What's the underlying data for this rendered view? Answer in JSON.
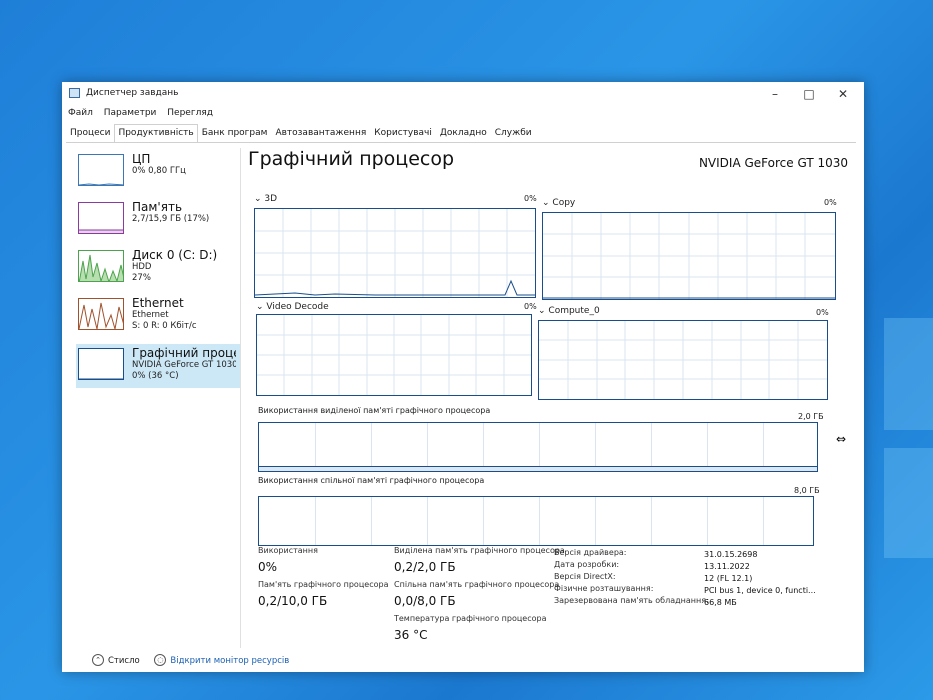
{
  "window": {
    "title": "Диспетчер завдань",
    "menu": [
      "Файл",
      "Параметри",
      "Перегляд"
    ],
    "tabs": [
      "Процеси",
      "Продуктивність",
      "Банк програм",
      "Автозавантаження",
      "Користувачі",
      "Докладно",
      "Служби"
    ],
    "active_tab": 1
  },
  "sidebar": {
    "items": [
      {
        "name": "ЦП",
        "sub1": "0% 0,80 ГГц",
        "sub2": "",
        "sub3": ""
      },
      {
        "name": "Пам'ять",
        "sub1": "2,7/15,9 ГБ (17%)",
        "sub2": "",
        "sub3": ""
      },
      {
        "name": "Диск 0 (C: D:)",
        "sub1": "HDD",
        "sub2": "27%",
        "sub3": ""
      },
      {
        "name": "Ethernet",
        "sub1": "Ethernet",
        "sub2": "S: 0 R: 0 Кбіт/с",
        "sub3": ""
      },
      {
        "name": "Графічний процес",
        "sub1": "NVIDIA GeForce GT 1030",
        "sub2": "0% (36 °C)",
        "sub3": ""
      }
    ]
  },
  "main": {
    "title": "Графічний процесор",
    "gpu_name": "NVIDIA GeForce GT 1030",
    "engines": [
      {
        "name": "3D",
        "pct": "0%"
      },
      {
        "name": "Copy",
        "pct": "0%"
      },
      {
        "name": "Video Decode",
        "pct": "0%"
      },
      {
        "name": "Compute_0",
        "pct": "0%"
      }
    ],
    "dedicated_label": "Використання виділеної пам'яті графічного процесора",
    "dedicated_max": "2,0 ГБ",
    "shared_label": "Використання спільної пам'яті графічного процесора",
    "shared_max": "8,0 ГБ"
  },
  "stats": {
    "usage_label": "Використання",
    "usage_value": "0%",
    "gpu_mem_label": "Пам'ять графічного процесора",
    "gpu_mem_value": "0,2/10,0 ГБ",
    "dedicated_label": "Виділена пам'ять графічного процесора",
    "dedicated_value": "0,2/2,0 ГБ",
    "shared_label": "Спільна пам'ять графічного процесора",
    "shared_value": "0,0/8,0 ГБ",
    "temp_label": "Температура графічного процесора",
    "temp_value": "36 °C"
  },
  "info": [
    {
      "key": "Версія драйвера:",
      "val": "31.0.15.2698"
    },
    {
      "key": "Дата розробки:",
      "val": "13.11.2022"
    },
    {
      "key": "Версія DirectX:",
      "val": "12 (FL 12.1)"
    },
    {
      "key": "Фізичне розташування:",
      "val": "PCI bus 1, device 0, functi..."
    },
    {
      "key": "Зарезервована пам'ять обладнання:",
      "val": "66,8 МБ"
    }
  ],
  "footer": {
    "less": "Стисло",
    "monitor": "Відкрити монітор ресурсів"
  },
  "colors": {
    "gpu_line": "#1a4e8a",
    "disk": "#4da34d",
    "ethernet": "#a0522d",
    "memory": "#8b3a9e",
    "selected": "#cce8f6"
  }
}
